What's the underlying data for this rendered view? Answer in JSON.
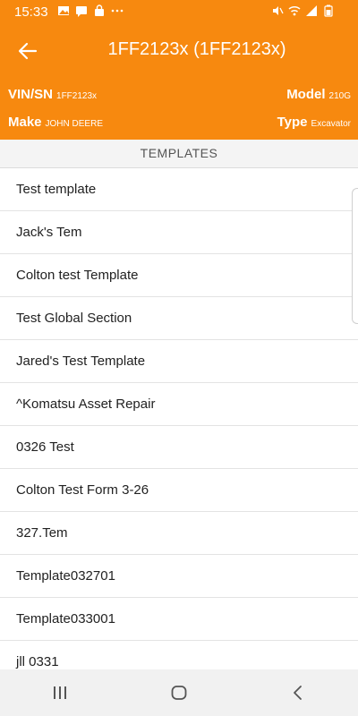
{
  "status_bar": {
    "time": "15:33",
    "left_icons": [
      "image-icon",
      "message-icon",
      "shopping-bag-icon",
      "more-dots-icon"
    ],
    "right_icons": [
      "mute-icon",
      "wifi-icon",
      "signal-icon",
      "battery-icon"
    ]
  },
  "header": {
    "title": "1FF2123x (1FF2123x)",
    "vin_label": "VIN/SN",
    "vin_value": "1FF2123x",
    "model_label": "Model",
    "model_value": "210G",
    "make_label": "Make",
    "make_value": "JOHN DEERE",
    "type_label": "Type",
    "type_value": "Excavator"
  },
  "templates_header": "TEMPLATES",
  "templates": [
    "Test template",
    "Jack's Tem",
    "Colton test Template",
    "Test Global Section",
    "Jared's Test Template",
    "^Komatsu Asset Repair",
    "0326 Test",
    "Colton Test Form 3-26",
    "327.Tem",
    "Template032701",
    "Template033001",
    "jll 0331"
  ],
  "colors": {
    "accent": "#F7890F",
    "nav_bar": "#f1f1f1"
  }
}
